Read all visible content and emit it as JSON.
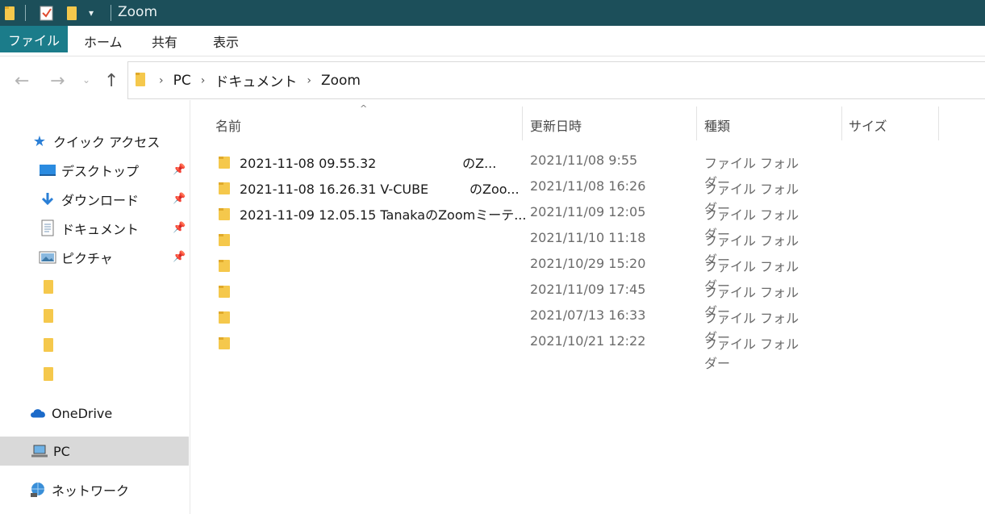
{
  "window": {
    "title": "Zoom"
  },
  "ribbon": {
    "file_tab": "ファイル",
    "tabs": [
      "ホーム",
      "共有",
      "表示"
    ]
  },
  "address": {
    "crumbs": [
      "PC",
      "ドキュメント",
      "Zoom"
    ]
  },
  "nav": {
    "quick_access": "クイック アクセス",
    "items": [
      "デスクトップ",
      "ダウンロード",
      "ドキュメント",
      "ピクチャ"
    ],
    "onedrive": "OneDrive",
    "pc": "PC",
    "network": "ネットワーク"
  },
  "columns": {
    "name": "名前",
    "modified": "更新日時",
    "type": "種類",
    "size": "サイズ"
  },
  "files": [
    {
      "name": "2021-11-08 09.55.32                     のZ...",
      "date": "2021/11/08 9:55",
      "type": "ファイル フォルダー"
    },
    {
      "name": "2021-11-08 16.26.31 V-CUBE          のZoo...",
      "date": "2021/11/08 16:26",
      "type": "ファイル フォルダー"
    },
    {
      "name": "2021-11-09 12.05.15 TanakaのZoomミーテ...",
      "date": "2021/11/09 12:05",
      "type": "ファイル フォルダー"
    },
    {
      "name": "",
      "date": "2021/11/10 11:18",
      "type": "ファイル フォルダー"
    },
    {
      "name": "",
      "date": "2021/10/29 15:20",
      "type": "ファイル フォルダー"
    },
    {
      "name": "",
      "date": "2021/11/09 17:45",
      "type": "ファイル フォルダー"
    },
    {
      "name": "",
      "date": "2021/07/13 16:33",
      "type": "ファイル フォルダー"
    },
    {
      "name": "",
      "date": "2021/10/21 12:22",
      "type": "ファイル フォルダー"
    }
  ],
  "colors": {
    "titlebar": "#1c4f5a",
    "file_tab": "#1b7c8a",
    "folder": "#f5c84c",
    "selected": "#d9d9d9"
  }
}
